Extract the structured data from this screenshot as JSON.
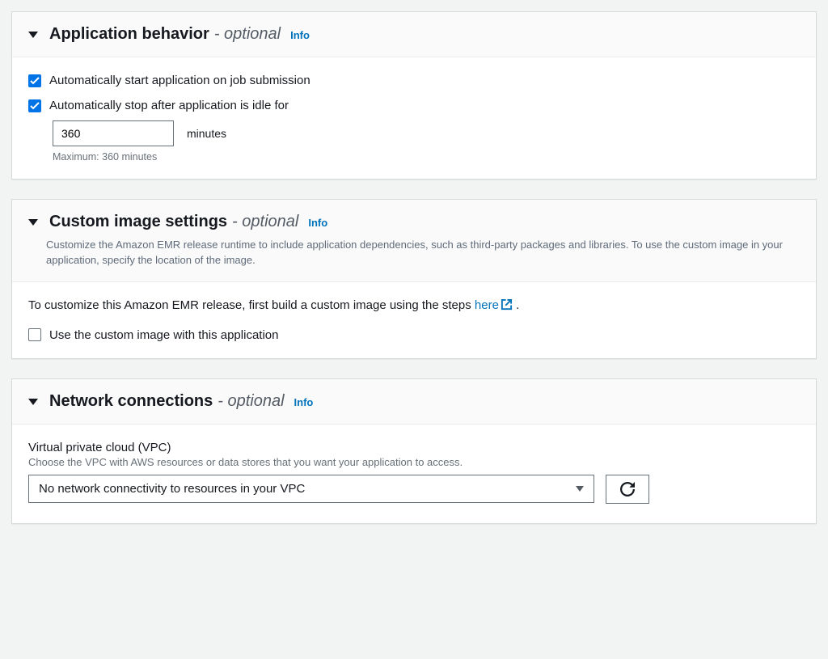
{
  "appBehavior": {
    "title": "Application behavior",
    "suffix": "optional",
    "info": "Info",
    "autoStart": {
      "checked": true,
      "label": "Automatically start application on job submission"
    },
    "autoStop": {
      "checked": true,
      "label": "Automatically stop after application is idle for",
      "value": "360",
      "unit": "minutes",
      "hint": "Maximum: 360 minutes"
    }
  },
  "customImage": {
    "title": "Custom image settings",
    "suffix": "optional",
    "info": "Info",
    "description": "Customize the Amazon EMR release runtime to include application dependencies, such as third-party packages and libraries. To use the custom image in your application, specify the location of the image.",
    "bodyTextPre": "To customize this Amazon EMR release, first build a custom image using the steps ",
    "link": "here",
    "bodyTextPost": " .",
    "useCustom": {
      "checked": false,
      "label": "Use the custom image with this application"
    }
  },
  "network": {
    "title": "Network connections",
    "suffix": "optional",
    "info": "Info",
    "vpc": {
      "label": "Virtual private cloud (VPC)",
      "desc": "Choose the VPC with AWS resources or data stores that you want your application to access.",
      "selected": "No network connectivity to resources in your VPC"
    }
  }
}
